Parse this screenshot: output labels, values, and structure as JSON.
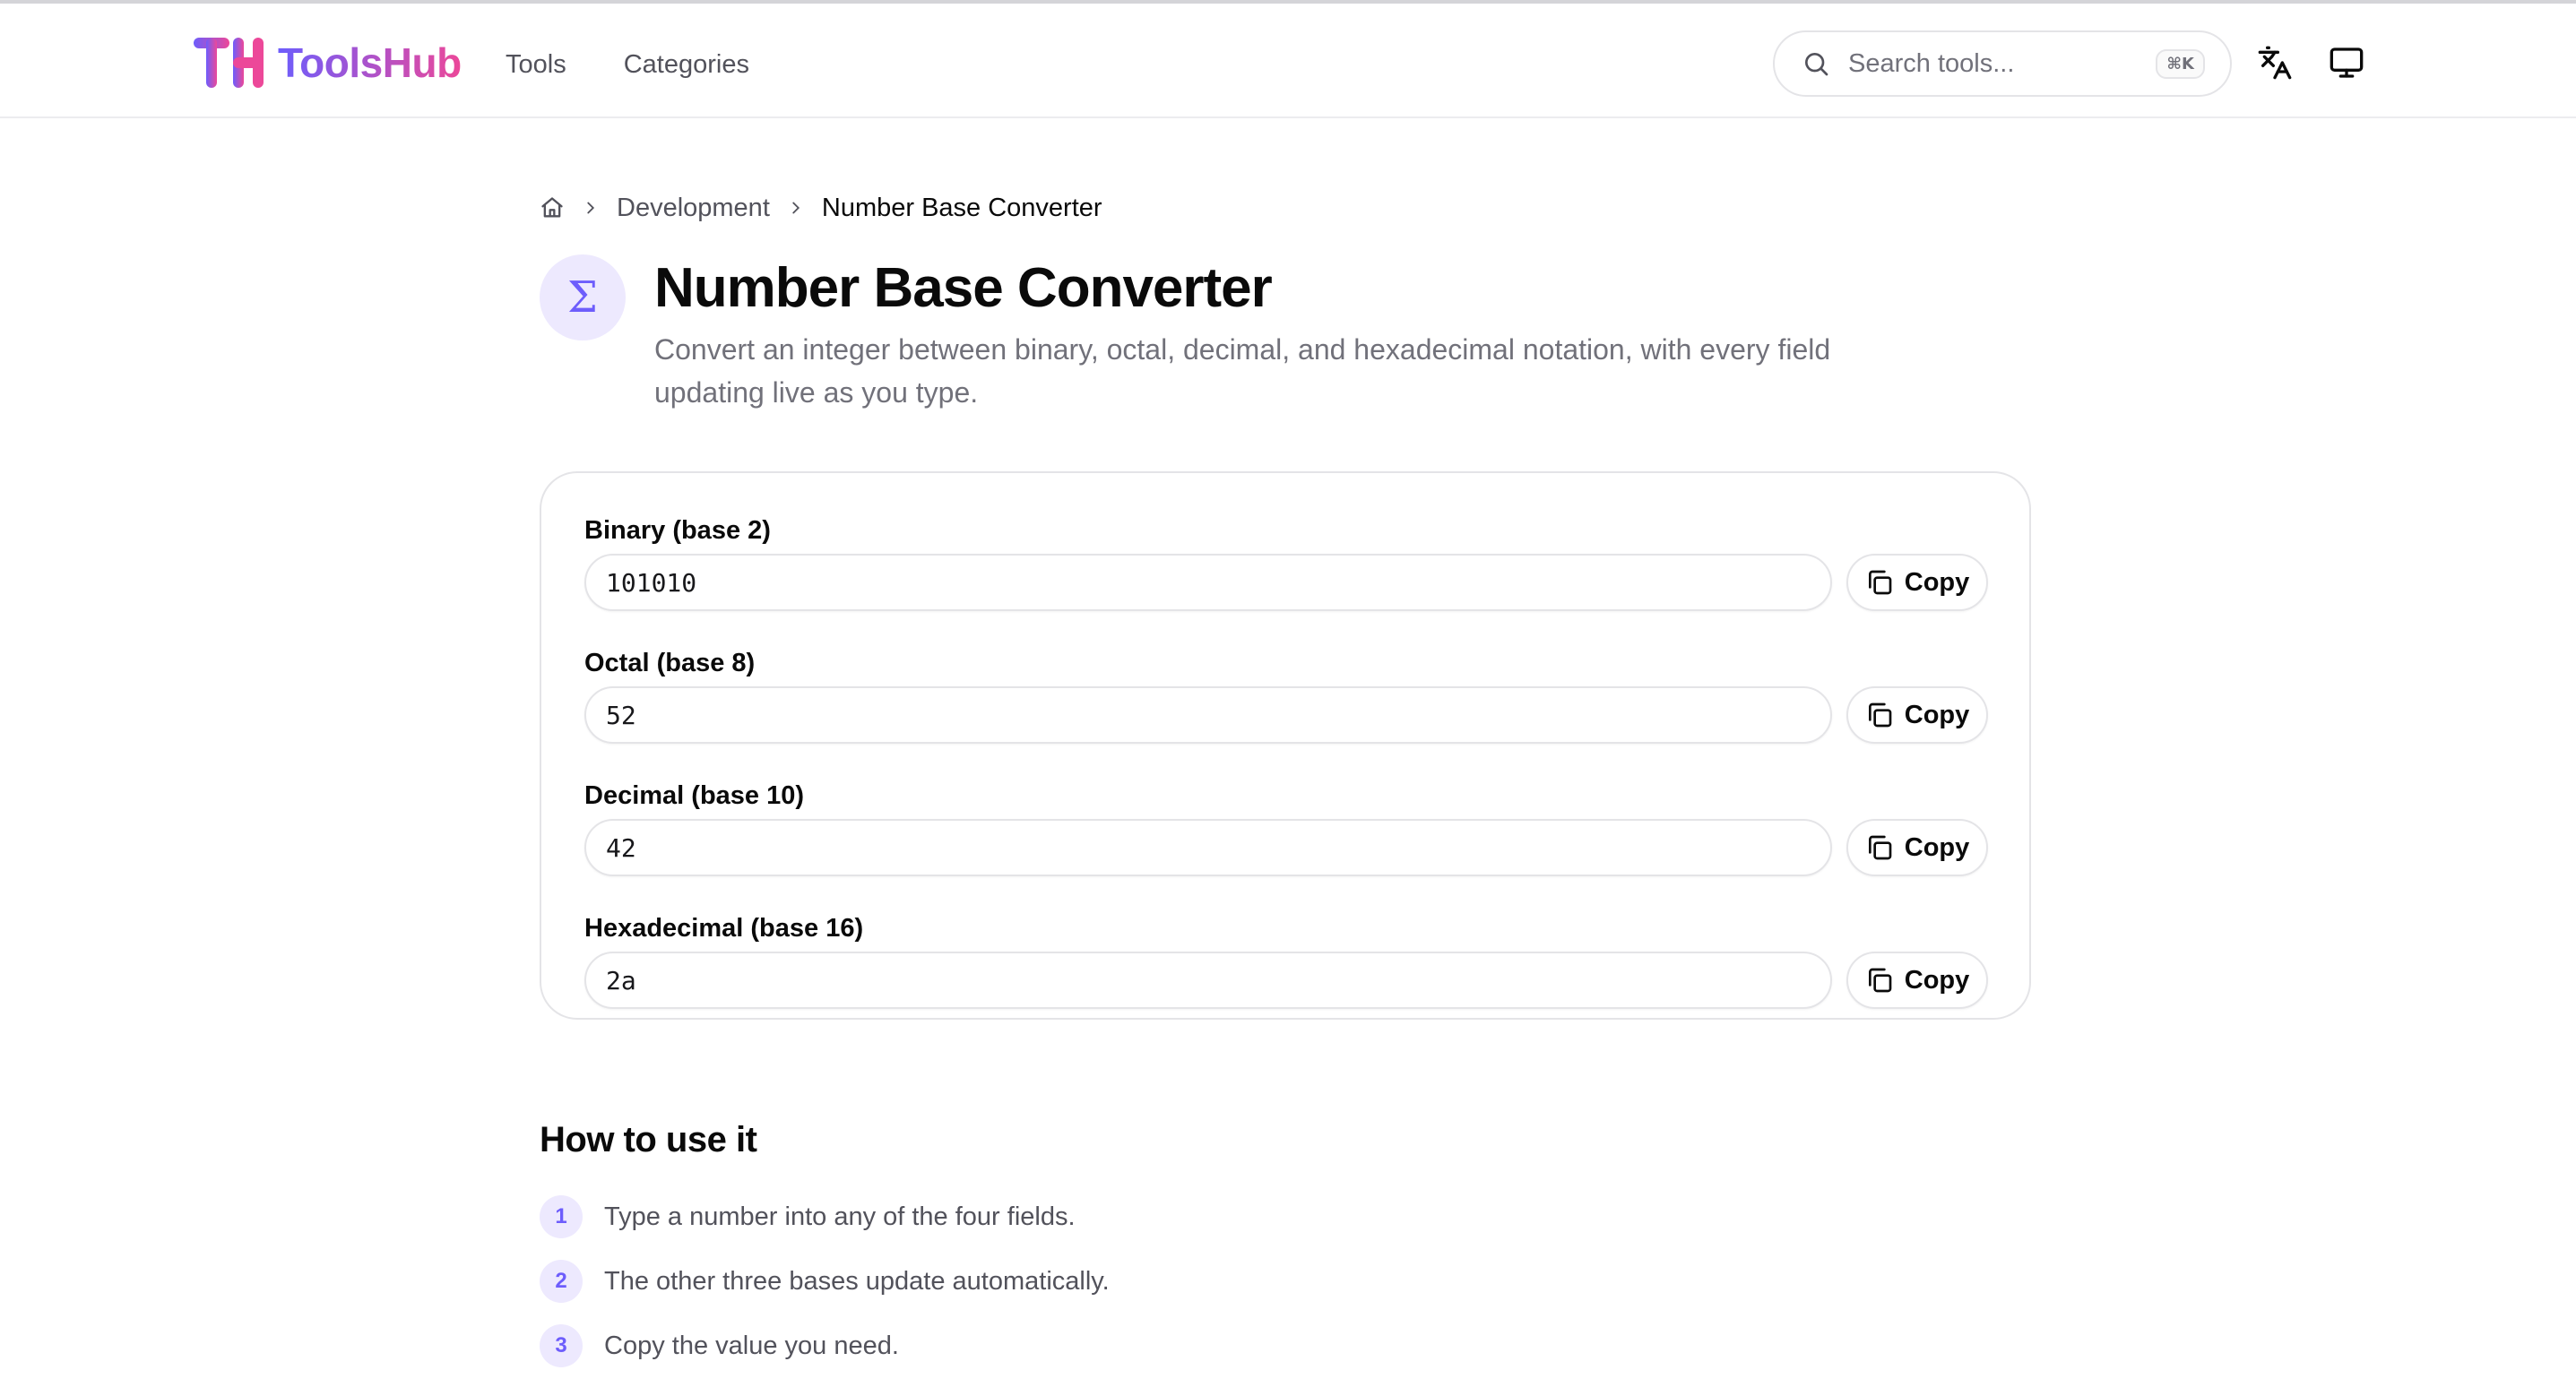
{
  "brand": {
    "name": "ToolsHub",
    "colors": {
      "start": "#6d5dfc",
      "end": "#ec4899"
    }
  },
  "nav": {
    "items": [
      {
        "label": "Tools"
      },
      {
        "label": "Categories"
      }
    ]
  },
  "search": {
    "placeholder": "Search tools...",
    "shortcut": "⌘K",
    "icon": "search-icon"
  },
  "header_actions": [
    {
      "icon": "translate-icon"
    },
    {
      "icon": "monitor-icon"
    }
  ],
  "breadcrumb": {
    "home_icon": "home-icon",
    "items": [
      "Development",
      "Number Base Converter"
    ]
  },
  "page": {
    "icon_glyph": "Σ",
    "title": "Number Base Converter",
    "description": "Convert an integer between binary, octal, decimal, and hexadecimal notation, with every field updating live as you type."
  },
  "converter": {
    "fields": [
      {
        "label": "Binary (base 2)",
        "value": "101010",
        "copy_label": "Copy"
      },
      {
        "label": "Octal (base 8)",
        "value": "52",
        "copy_label": "Copy"
      },
      {
        "label": "Decimal (base 10)",
        "value": "42",
        "copy_label": "Copy"
      },
      {
        "label": "Hexadecimal (base 16)",
        "value": "2a",
        "copy_label": "Copy"
      }
    ]
  },
  "howto": {
    "title": "How to use it",
    "steps": [
      {
        "num": "1",
        "text": "Type a number into any of the four fields."
      },
      {
        "num": "2",
        "text": "The other three bases update automatically."
      },
      {
        "num": "3",
        "text": "Copy the value you need."
      }
    ]
  }
}
